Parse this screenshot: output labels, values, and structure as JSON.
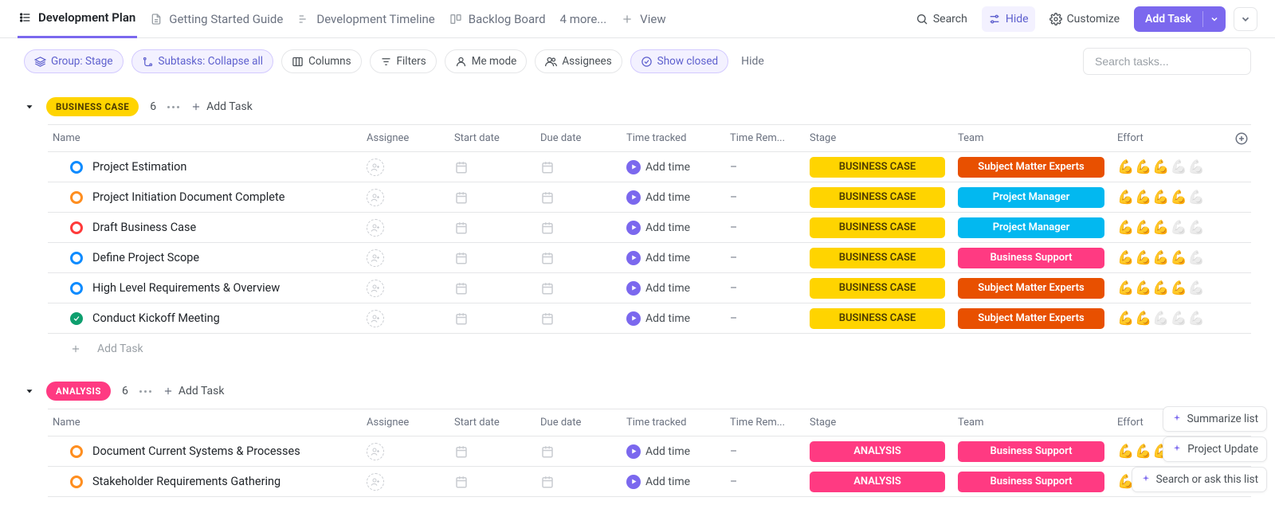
{
  "nav_tabs": [
    {
      "label": "Development Plan",
      "active": true
    },
    {
      "label": "Getting Started Guide",
      "active": false
    },
    {
      "label": "Development Timeline",
      "active": false
    },
    {
      "label": "Backlog Board",
      "active": false
    }
  ],
  "nav_more": "4 more...",
  "nav_view": "View",
  "topright": {
    "search": "Search",
    "hide": "Hide",
    "customize": "Customize",
    "add_task": "Add Task"
  },
  "toolbar": {
    "group_chip": "Group: Stage",
    "subtasks_chip": "Subtasks: Collapse all",
    "columns": "Columns",
    "filters": "Filters",
    "me_mode": "Me mode",
    "assignees": "Assignees",
    "show_closed": "Show closed",
    "hide": "Hide",
    "search_placeholder": "Search tasks..."
  },
  "columns": {
    "name": "Name",
    "assignee": "Assignee",
    "start": "Start date",
    "due": "Due date",
    "time": "Time tracked",
    "remain": "Time Rem...",
    "stage": "Stage",
    "team": "Team",
    "effort": "Effort"
  },
  "add_time_label": "Add time",
  "dash": "–",
  "add_task_row": "Add Task",
  "group_add_task": "Add Task",
  "groups": [
    {
      "label": "BUSINESS CASE",
      "badge_class": "y",
      "count": "6",
      "stage_label": "BUSINESS CASE",
      "stage_class": "s-y",
      "tasks": [
        {
          "name": "Project Estimation",
          "status": "open-blue",
          "team": "Subject Matter Experts",
          "team_class": "t-orange",
          "effort": 3
        },
        {
          "name": "Project Initiation Document Complete",
          "status": "open-orange",
          "team": "Project Manager",
          "team_class": "t-blue",
          "effort": 4
        },
        {
          "name": "Draft Business Case",
          "status": "open-red",
          "team": "Project Manager",
          "team_class": "t-blue",
          "effort": 3
        },
        {
          "name": "Define Project Scope",
          "status": "open-blue",
          "team": "Business Support",
          "team_class": "t-pink",
          "effort": 4
        },
        {
          "name": "High Level Requirements & Overview",
          "status": "open-blue",
          "team": "Subject Matter Experts",
          "team_class": "t-orange",
          "effort": 4
        },
        {
          "name": "Conduct Kickoff Meeting",
          "status": "done",
          "team": "Subject Matter Experts",
          "team_class": "t-orange",
          "effort": 2
        }
      ]
    },
    {
      "label": "ANALYSIS",
      "badge_class": "p",
      "count": "6",
      "stage_label": "ANALYSIS",
      "stage_class": "s-p",
      "tasks": [
        {
          "name": "Document Current Systems & Processes",
          "status": "open-orange",
          "team": "Business Support",
          "team_class": "t-pink",
          "effort": 4
        },
        {
          "name": "Stakeholder Requirements Gathering",
          "status": "open-orange",
          "team": "Business Support",
          "team_class": "t-pink",
          "effort": 4
        }
      ]
    }
  ],
  "ai": {
    "summarize": "Summarize list",
    "update": "Project Update",
    "search": "Search or ask this list"
  }
}
